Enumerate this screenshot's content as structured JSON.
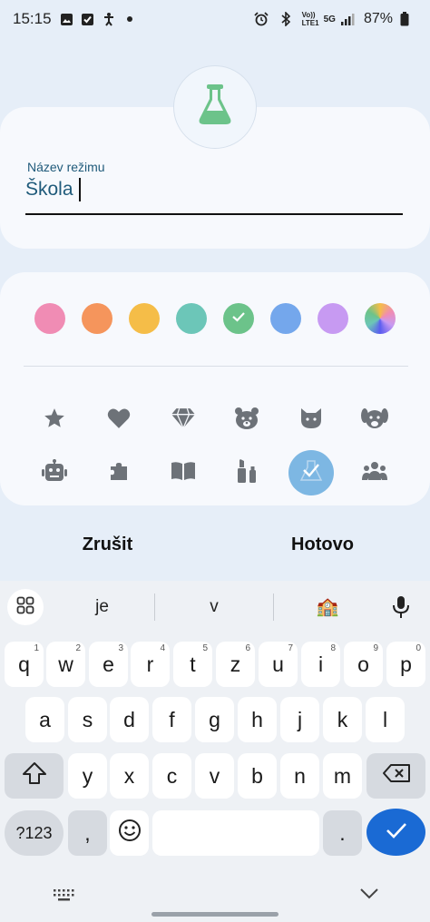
{
  "status_bar": {
    "time": "15:15",
    "battery": "87%",
    "left_icons": [
      "image-icon",
      "check-square-icon",
      "accessibility-icon",
      "dot-icon"
    ],
    "right_icons": [
      "alarm-icon",
      "bluetooth-icon",
      "volte-icon",
      "5g-icon",
      "signal-icon",
      "battery-icon"
    ],
    "volte_label": "Vo)) LTE1",
    "network_label": "5G"
  },
  "mode": {
    "icon": "flask-icon",
    "name_label": "Název režimu",
    "name_value": "Škola"
  },
  "colors": [
    {
      "name": "pink",
      "hex": "#f08cb4",
      "selected": false
    },
    {
      "name": "orange",
      "hex": "#f5955c",
      "selected": false
    },
    {
      "name": "yellow",
      "hex": "#f5bd48",
      "selected": false
    },
    {
      "name": "teal",
      "hex": "#6cc6b8",
      "selected": false
    },
    {
      "name": "green",
      "hex": "#6cc38a",
      "selected": true
    },
    {
      "name": "blue",
      "hex": "#74a7ec",
      "selected": false
    },
    {
      "name": "purple",
      "hex": "#c79af2",
      "selected": false
    },
    {
      "name": "custom-gradient",
      "hex": "gradient",
      "selected": false
    }
  ],
  "icons": [
    {
      "name": "star-icon",
      "selected": false
    },
    {
      "name": "heart-icon",
      "selected": false
    },
    {
      "name": "diamond-icon",
      "selected": false
    },
    {
      "name": "bear-icon",
      "selected": false
    },
    {
      "name": "cat-icon",
      "selected": false
    },
    {
      "name": "dog-icon",
      "selected": false
    },
    {
      "name": "robot-icon",
      "selected": false
    },
    {
      "name": "puzzle-icon",
      "selected": false
    },
    {
      "name": "book-icon",
      "selected": false
    },
    {
      "name": "cosmetics-icon",
      "selected": false
    },
    {
      "name": "flask-icon",
      "selected": true
    },
    {
      "name": "people-icon",
      "selected": false
    }
  ],
  "actions": {
    "cancel": "Zrušit",
    "done": "Hotovo"
  },
  "keyboard": {
    "suggestions": [
      "je",
      "v",
      "🏫"
    ],
    "row1": [
      [
        "q",
        "1"
      ],
      [
        "w",
        "2"
      ],
      [
        "e",
        "3"
      ],
      [
        "r",
        "4"
      ],
      [
        "t",
        "5"
      ],
      [
        "z",
        "6"
      ],
      [
        "u",
        "7"
      ],
      [
        "i",
        "8"
      ],
      [
        "o",
        "9"
      ],
      [
        "p",
        "0"
      ]
    ],
    "row2": [
      "a",
      "s",
      "d",
      "f",
      "g",
      "h",
      "j",
      "k",
      "l"
    ],
    "row3": [
      "y",
      "x",
      "c",
      "v",
      "b",
      "n",
      "m"
    ],
    "sym_label": "?123",
    "comma": ",",
    "period": "."
  }
}
